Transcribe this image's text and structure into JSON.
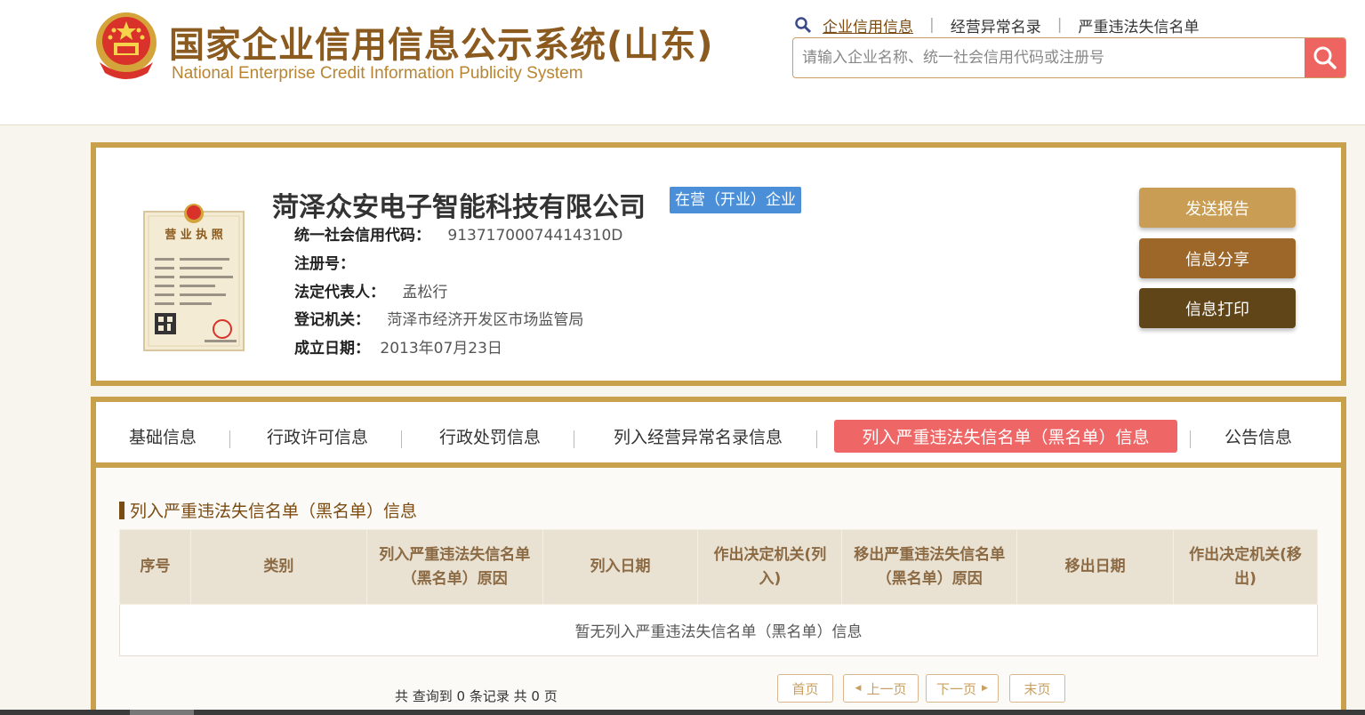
{
  "header": {
    "title": "国家企业信用信息公示系统(山东)",
    "subtitle": "National Enterprise Credit Information Publicity System",
    "links": [
      "企业信用信息",
      "经营异常名录",
      "严重违法失信名单"
    ],
    "search_placeholder": "请输入企业名称、统一社会信用代码或注册号"
  },
  "company": {
    "name": "菏泽众安电子智能科技有限公司",
    "status": "在营（开业）企业",
    "fields": [
      {
        "label": "统一社会信用代码：",
        "value": "91371700074414310D"
      },
      {
        "label": "注册号：",
        "value": ""
      },
      {
        "label": "法定代表人：",
        "value": "孟松行"
      },
      {
        "label": "登记机关：",
        "value": "菏泽市经济开发区市场监管局"
      },
      {
        "label": "成立日期：",
        "value": "2013年07月23日"
      }
    ],
    "license_title": "营 业 执 照",
    "actions": [
      "发送报告",
      "信息分享",
      "信息打印"
    ]
  },
  "tabs": [
    "基础信息",
    "行政许可信息",
    "行政处罚信息",
    "列入经营异常名录信息",
    "列入严重违法失信名单（黑名单）信息",
    "公告信息"
  ],
  "section": {
    "title": "列入严重违法失信名单（黑名单）信息",
    "columns": [
      "序号",
      "类别",
      "列入严重违法失信名单（黑名单）原因",
      "列入日期",
      "作出决定机关(列入)",
      "移出严重违法失信名单（黑名单）原因",
      "移出日期",
      "作出决定机关(移出)"
    ],
    "empty_text": "暂无列入严重违法失信名单（黑名单）信息"
  },
  "pagination": {
    "summary": "共 查询到 0 条记录 共 0 页",
    "first": "首页",
    "prev": "上一页",
    "next": "下一页",
    "last": "末页"
  },
  "colors": {
    "brand_gold": "#c9a04c",
    "brand_brown": "#8b5a1f",
    "active_tab": "#ee6766",
    "status_blue": "#4a8fd8"
  }
}
